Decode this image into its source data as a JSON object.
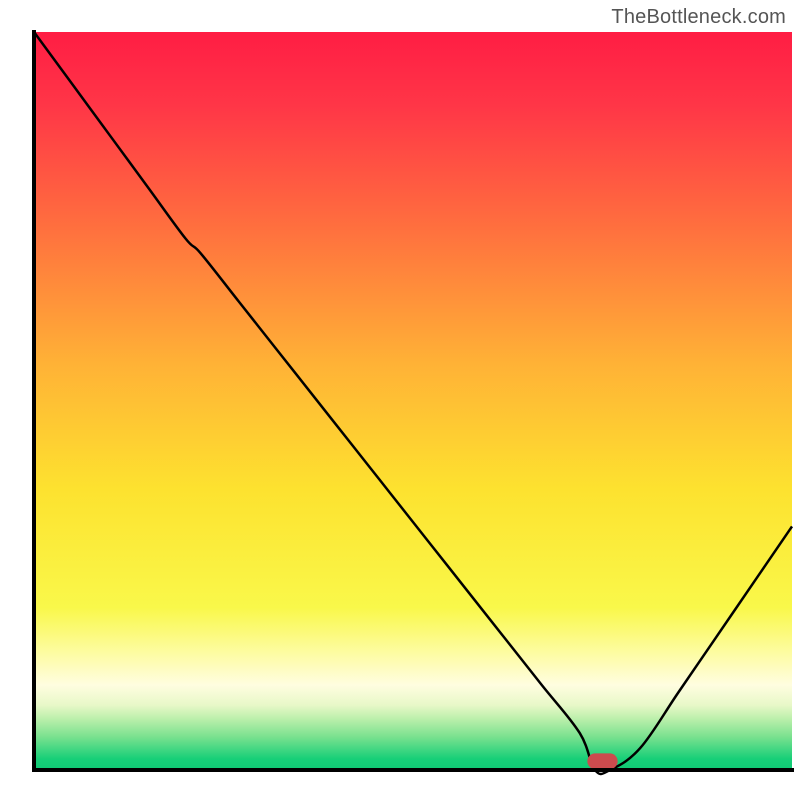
{
  "watermark": "TheBottleneck.com",
  "chart_data": {
    "type": "line",
    "title": "",
    "xlabel": "",
    "ylabel": "",
    "x": [
      0,
      5,
      10,
      15,
      20,
      22,
      27,
      32,
      37,
      42,
      47,
      52,
      57,
      62,
      67,
      72,
      74,
      76,
      80,
      85,
      90,
      95,
      100
    ],
    "y": [
      100,
      93,
      86,
      79,
      72,
      70,
      63.5,
      57,
      50.5,
      44,
      37.5,
      31,
      24.5,
      18,
      11.5,
      5,
      0,
      0,
      3,
      10.5,
      18,
      25.5,
      33
    ],
    "xlim": [
      0,
      100
    ],
    "ylim": [
      0,
      100
    ],
    "marker": {
      "x": 75,
      "y": 0,
      "width": 4,
      "height": 1.3,
      "color": "#cc4b4e"
    },
    "gradient_stops": [
      {
        "offset": 0.0,
        "color": "#ff1d44"
      },
      {
        "offset": 0.1,
        "color": "#ff3647"
      },
      {
        "offset": 0.25,
        "color": "#ff6a3f"
      },
      {
        "offset": 0.45,
        "color": "#ffb236"
      },
      {
        "offset": 0.62,
        "color": "#fde22f"
      },
      {
        "offset": 0.78,
        "color": "#f9f84a"
      },
      {
        "offset": 0.84,
        "color": "#fdfca0"
      },
      {
        "offset": 0.885,
        "color": "#fffde0"
      },
      {
        "offset": 0.912,
        "color": "#e8f8c8"
      },
      {
        "offset": 0.93,
        "color": "#bdf0ac"
      },
      {
        "offset": 0.955,
        "color": "#7ae18f"
      },
      {
        "offset": 0.985,
        "color": "#17cf78"
      },
      {
        "offset": 1.0,
        "color": "#0fc974"
      }
    ],
    "axis_color": "#000000",
    "axis_width": 4
  }
}
